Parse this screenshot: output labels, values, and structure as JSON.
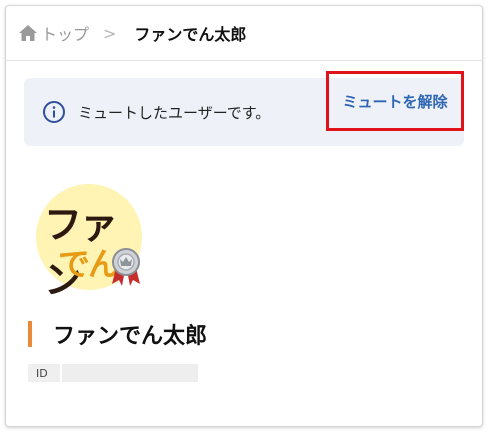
{
  "breadcrumb": {
    "home_label": "トップ",
    "separator": ">",
    "current": "ファンでん太郎"
  },
  "notice": {
    "icon": "info-icon",
    "message": "ミュートしたユーザーです。",
    "unmute_label": "ミュートを解除"
  },
  "profile": {
    "avatar_text_line1": "ファン",
    "avatar_text_line2": "でん",
    "rank_badge_icon": "silver-medal-icon",
    "name": "ファンでん太郎",
    "id_label": "ID",
    "id_value": ""
  },
  "colors": {
    "accent_orange": "#e98a3a",
    "link_blue": "#2f66b3",
    "highlight_red": "#e0121a",
    "notice_bg": "#eef1f8"
  }
}
